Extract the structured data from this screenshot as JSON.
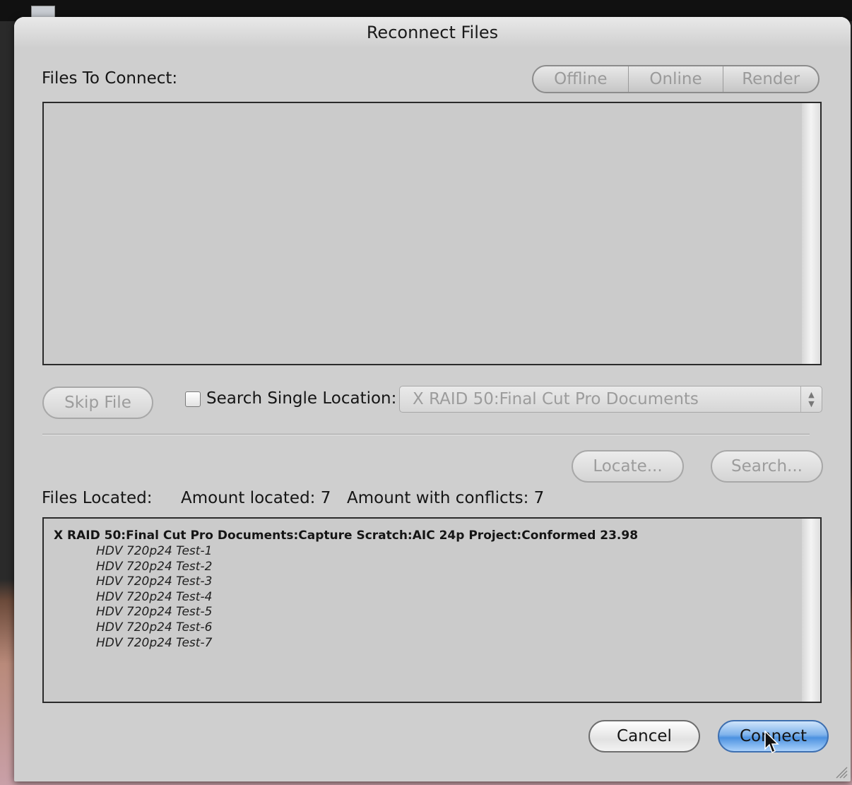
{
  "window": {
    "title": "Reconnect Files"
  },
  "files_to_connect": {
    "label": "Files To Connect:",
    "filters": [
      "Offline",
      "Online",
      "Render"
    ]
  },
  "controls": {
    "skip_file_label": "Skip File",
    "search_single_label": "Search Single Location:",
    "search_single_checked": false,
    "location_value": "X RAID 50:Final Cut Pro Documents",
    "locate_label": "Locate...",
    "search_label": "Search..."
  },
  "files_located": {
    "label": "Files Located:",
    "amount_located": "Amount located: 7",
    "amount_conflicts": "Amount with conflicts: 7",
    "path": "X RAID 50:Final Cut Pro Documents:Capture Scratch:AIC 24p Project:Conformed 23.98",
    "items": [
      "HDV 720p24 Test-1",
      "HDV 720p24 Test-2",
      "HDV 720p24 Test-3",
      "HDV 720p24 Test-4",
      "HDV 720p24 Test-5",
      "HDV 720p24 Test-6",
      "HDV 720p24 Test-7"
    ]
  },
  "buttons": {
    "cancel": "Cancel",
    "connect": "Connect"
  },
  "colors": {
    "dialog_bg": "#cfcfcf",
    "default_button": "#4c92e0",
    "disabled_text": "#9c9c9c"
  },
  "icons": [
    "mouse-pointer-icon",
    "resize-grip-icon",
    "popup-arrows-icon"
  ]
}
